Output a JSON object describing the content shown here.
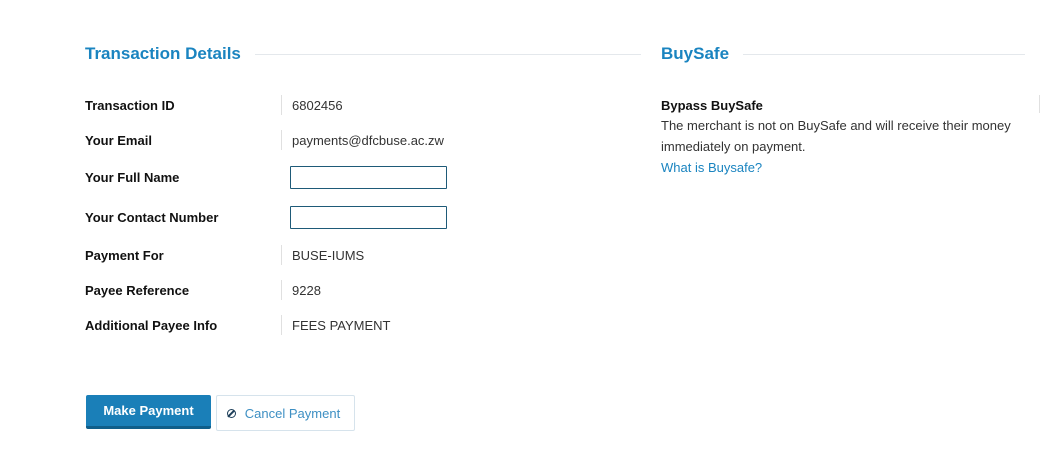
{
  "transaction_details": {
    "title": "Transaction Details",
    "rows": [
      {
        "label": "Transaction ID",
        "value": "6802456"
      },
      {
        "label": "Your Email",
        "value": "payments@dfcbuse.ac.zw"
      },
      {
        "label": "Your Full Name",
        "value": ""
      },
      {
        "label": "Your Contact Number",
        "value": ""
      },
      {
        "label": "Payment For",
        "value": "BUSE-IUMS"
      },
      {
        "label": "Payee Reference",
        "value": "9228"
      },
      {
        "label": "Additional Payee Info",
        "value": "FEES PAYMENT"
      }
    ]
  },
  "buysafe": {
    "title": "BuySafe",
    "option_title": "Bypass BuySafe",
    "description": "The merchant is not on BuySafe and will receive their money immediately on payment.",
    "link_text": "What is Buysafe?"
  },
  "actions": {
    "make_payment_label": "Make Payment",
    "cancel_payment_label": "Cancel Payment",
    "cancel_icon": "ban-icon"
  },
  "colors": {
    "accent": "#1a84c0",
    "primary_button": "#1a7fb8",
    "input_border": "#1e5a78"
  }
}
